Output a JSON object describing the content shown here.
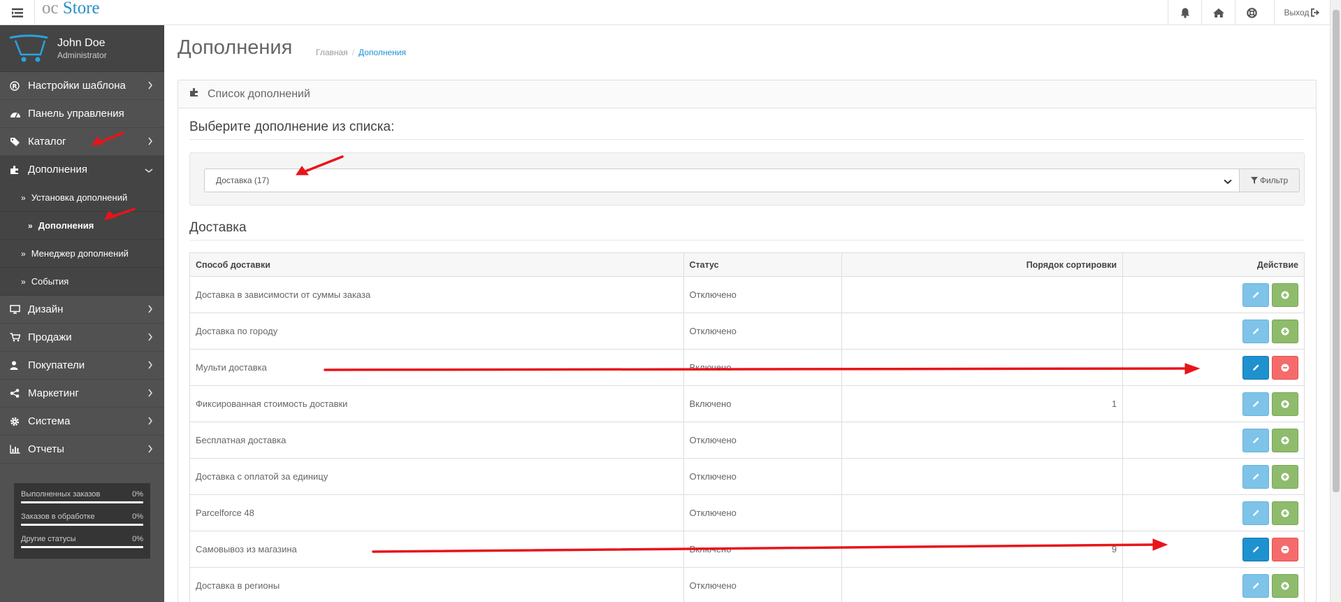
{
  "header": {
    "logo_oc": "oc",
    "logo_store": "Store",
    "logout_label": "Выход"
  },
  "profile": {
    "name": "John Doe",
    "role": "Administrator"
  },
  "sidebar": {
    "items": [
      {
        "label": "Настройки шаблона",
        "icon": "registered-icon",
        "chevron": true
      },
      {
        "label": "Панель управления",
        "icon": "dashboard-icon",
        "chevron": false
      },
      {
        "label": "Каталог",
        "icon": "tags-icon",
        "chevron": true
      },
      {
        "label": "Дополнения",
        "icon": "puzzle-icon",
        "chevron": true,
        "expanded": true
      },
      {
        "label": "Дизайн",
        "icon": "monitor-icon",
        "chevron": true
      },
      {
        "label": "Продажи",
        "icon": "cart-icon",
        "chevron": true
      },
      {
        "label": "Покупатели",
        "icon": "user-icon",
        "chevron": true
      },
      {
        "label": "Маркетинг",
        "icon": "share-icon",
        "chevron": true
      },
      {
        "label": "Система",
        "icon": "cog-icon",
        "chevron": true
      },
      {
        "label": "Отчеты",
        "icon": "bar-chart-icon",
        "chevron": true
      }
    ],
    "subitems": [
      {
        "label": "Установка дополнений"
      },
      {
        "label": "Дополнения"
      },
      {
        "label": "Менеджер дополнений"
      },
      {
        "label": "События"
      }
    ]
  },
  "stats": [
    {
      "label": "Выполненных заказов",
      "value": "0%"
    },
    {
      "label": "Заказов в обработке",
      "value": "0%"
    },
    {
      "label": "Другие статусы",
      "value": "0%"
    }
  ],
  "page": {
    "title": "Дополнения",
    "breadcrumb": [
      "Главная",
      "Дополнения"
    ]
  },
  "panel": {
    "heading": "Список дополнений",
    "choose_label": "Выберите дополнение из списка:",
    "select_value": "Доставка (17)",
    "filter_label": "Фильтр",
    "section_title": "Доставка"
  },
  "table": {
    "headers": [
      "Способ доставки",
      "Статус",
      "Порядок сортировки",
      "Действие"
    ],
    "rows": [
      {
        "method": "Доставка в зависимости от суммы заказа",
        "status": "Отключено",
        "sort": "",
        "installed": false
      },
      {
        "method": "Доставка по городу",
        "status": "Отключено",
        "sort": "",
        "installed": false
      },
      {
        "method": "Мульти доставка",
        "status": "Включено",
        "sort": "",
        "installed": true
      },
      {
        "method": "Фиксированная стоимость доставки",
        "status": "Включено",
        "sort": "1",
        "installed": false
      },
      {
        "method": "Бесплатная доставка",
        "status": "Отключено",
        "sort": "",
        "installed": false
      },
      {
        "method": "Доставка с оплатой за единицу",
        "status": "Отключено",
        "sort": "",
        "installed": false
      },
      {
        "method": "Parcelforce 48",
        "status": "Отключено",
        "sort": "",
        "installed": false
      },
      {
        "method": "Самовывоз из магазина",
        "status": "Включено",
        "sort": "9",
        "installed": true
      },
      {
        "method": "Доставка в регионы",
        "status": "Отключено",
        "sort": "",
        "installed": false
      }
    ]
  },
  "colors": {
    "sidebar_bg": "#515151",
    "accent_blue": "#1e91cf",
    "install_green": "#8fbb6c",
    "uninstall_red": "#f56b6b",
    "annotation_red": "#e8141b"
  }
}
